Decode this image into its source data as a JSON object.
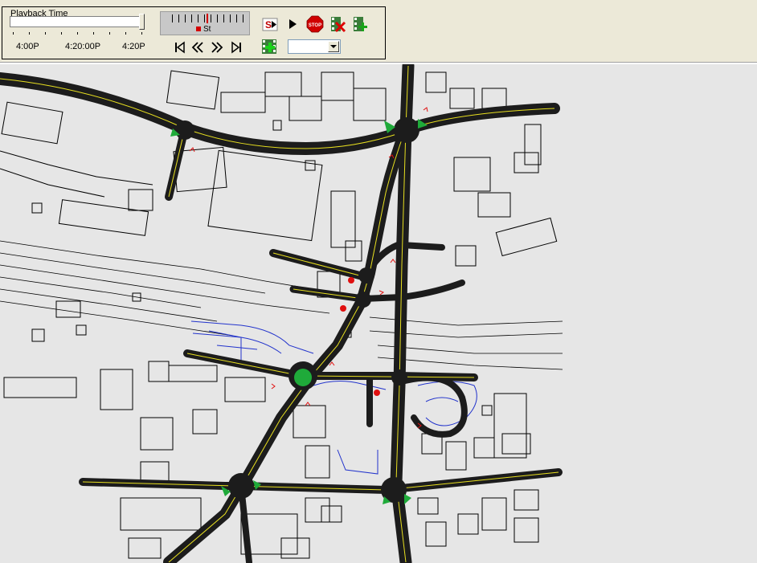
{
  "playback": {
    "group_title": "Playback Time",
    "time_labels": [
      "4:00P",
      "4:20:00P",
      "4:20P"
    ],
    "slider_position": 1.0
  },
  "speed": {
    "label": "St"
  },
  "buttons": {
    "start_icon_text": "S",
    "stop_icon_text": "STOP"
  },
  "dropdown": {
    "selected": ""
  },
  "colors": {
    "window_bg": "#ece9d8",
    "map_bg": "#e6e6e6",
    "road": "#1c1c1c",
    "road_marking": "#e8e020",
    "node_green": "#1faa3a",
    "vehicle_red": "#e01010",
    "path_blue": "#2233cc"
  },
  "icons": [
    "start-signal-icon",
    "play-icon",
    "stop-icon",
    "delete-frame-icon",
    "add-frame-icon",
    "skip-to-start-icon",
    "rewind-icon",
    "fast-forward-icon",
    "skip-to-end-icon",
    "add-film-icon"
  ]
}
